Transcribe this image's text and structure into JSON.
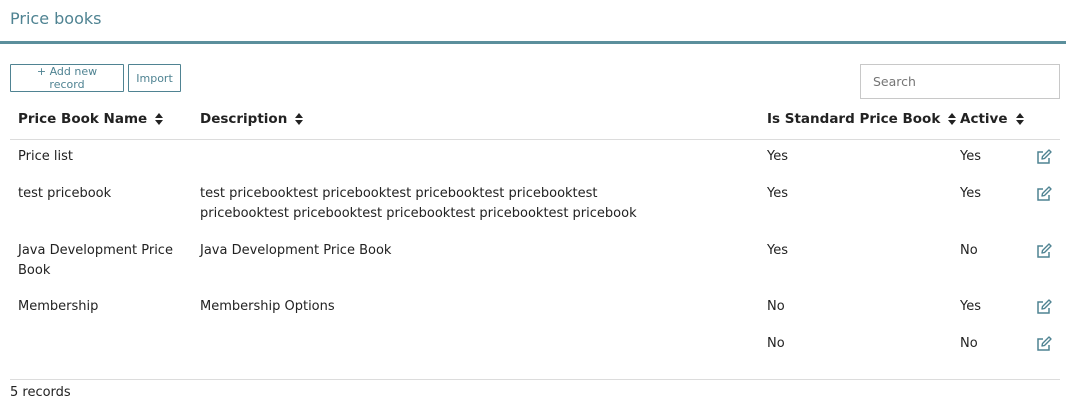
{
  "page": {
    "title": "Price books"
  },
  "toolbar": {
    "add_label": "+ Add new record",
    "import_label": "Import"
  },
  "search": {
    "placeholder": "Search",
    "value": ""
  },
  "table": {
    "columns": [
      "Price Book Name",
      "Description",
      "Is Standard Price Book",
      "Active"
    ],
    "rows": [
      {
        "name": "Price list",
        "description": "",
        "is_standard": "Yes",
        "active": "Yes"
      },
      {
        "name": "test pricebook",
        "description": "test pricebooktest pricebooktest pricebooktest pricebooktest pricebooktest pricebooktest pricebooktest pricebooktest pricebook",
        "is_standard": "Yes",
        "active": "Yes"
      },
      {
        "name": "Java Development Price Book",
        "description": "Java Development Price Book",
        "is_standard": "Yes",
        "active": "No"
      },
      {
        "name": "Membership",
        "description": "Membership Options",
        "is_standard": "No",
        "active": "Yes"
      },
      {
        "name": "",
        "description": "",
        "is_standard": "No",
        "active": "No"
      }
    ]
  },
  "footer": {
    "records": "5 records"
  },
  "icons": {
    "edit": "edit-icon",
    "sort": "sort-icon"
  },
  "colors": {
    "accent": "#4f8392",
    "header_rule": "#5b8f9c"
  }
}
